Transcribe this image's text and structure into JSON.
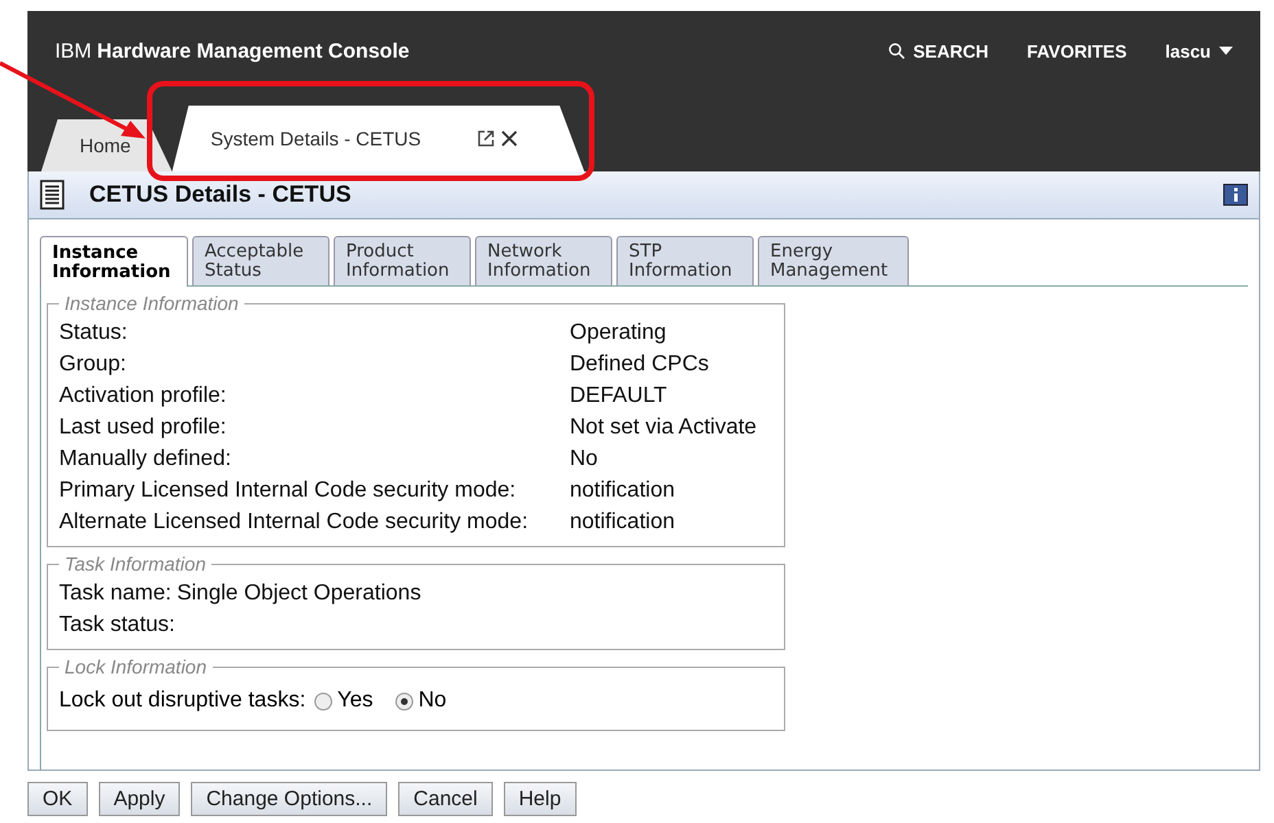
{
  "header": {
    "brand": "IBM",
    "product": "Hardware Management Console",
    "search": "SEARCH",
    "favorites": "FAVORITES",
    "user": "lascu"
  },
  "page_tabs": [
    {
      "label": "Home",
      "selected": false,
      "closable": false
    },
    {
      "label": "System Details - CETUS",
      "selected": true,
      "closable": true
    }
  ],
  "panel": {
    "title": "CETUS Details - CETUS"
  },
  "tabs": [
    {
      "label": "Instance Information",
      "selected": true
    },
    {
      "label": "Acceptable Status",
      "selected": false
    },
    {
      "label": "Product Information",
      "selected": false
    },
    {
      "label": "Network Information",
      "selected": false
    },
    {
      "label": "STP Information",
      "selected": false
    },
    {
      "label": "Energy Management",
      "selected": false
    }
  ],
  "instance": {
    "legend": "Instance Information",
    "rows": [
      {
        "label": "Status:",
        "value": "Operating"
      },
      {
        "label": "Group:",
        "value": "Defined CPCs"
      },
      {
        "label": "Activation profile:",
        "value": "DEFAULT"
      },
      {
        "label": "Last used profile:",
        "value": "Not set via Activate"
      },
      {
        "label": "Manually defined:",
        "value": "No"
      },
      {
        "label": "Primary Licensed Internal Code security mode:",
        "value": "notification"
      },
      {
        "label": "Alternate Licensed Internal Code security mode:",
        "value": "notification"
      }
    ]
  },
  "task": {
    "legend": "Task Information",
    "rows": [
      {
        "label": "Task name:",
        "value": "Single Object Operations"
      },
      {
        "label": "Task status:"
      }
    ]
  },
  "lock": {
    "legend": "Lock Information",
    "label": "Lock out disruptive tasks:",
    "options": [
      {
        "label": "Yes",
        "selected": false
      },
      {
        "label": "No",
        "selected": true
      }
    ]
  },
  "buttons": [
    "OK",
    "Apply",
    "Change Options...",
    "Cancel",
    "Help"
  ]
}
